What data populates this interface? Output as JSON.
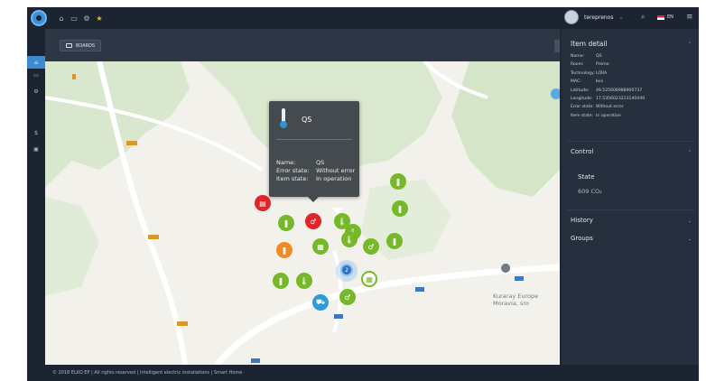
{
  "colors": {
    "accent": "#3a8bd1",
    "panel_bg": "#262f3d",
    "sensor_green": "#76b82a",
    "sensor_red": "#e0262a",
    "sensor_orange": "#f08a24",
    "sensor_blue": "#2f9bd8"
  },
  "topbar": {
    "user_name": "tereprenos",
    "language": "EN",
    "icons": [
      "home-icon",
      "boards-icon",
      "settings-icon",
      "star-icon",
      "search-icon",
      "hamburger-menu-icon"
    ]
  },
  "sidebar": {
    "items": [
      {
        "icon": "home-icon",
        "label": "⌂"
      },
      {
        "icon": "boards-icon",
        "label": "▭"
      },
      {
        "icon": "settings-icon",
        "label": "⚙"
      },
      {
        "icon": "dollar-icon",
        "label": "$"
      },
      {
        "icon": "id-card-icon",
        "label": "▣"
      }
    ]
  },
  "boards": {
    "label": "BOARDS"
  },
  "popup": {
    "title": "QS",
    "name_label": "Name:",
    "name_value": "QS",
    "error_label": "Error state:",
    "error_value": "Without error",
    "item_label": "Item state:",
    "item_value": "In operation"
  },
  "map": {
    "place_name_line1": "Kuraray Europe",
    "place_name_line2": "Moravia, sro",
    "cluster_count": "2",
    "road_labels": [
      "435",
      "432",
      "432",
      "432",
      "4347",
      "4347",
      "4347",
      "432"
    ]
  },
  "panel": {
    "item_detail_title": "Item detail",
    "details": [
      {
        "k": "Name:",
        "v": "QS"
      },
      {
        "k": "Room:",
        "v": "Promo"
      },
      {
        "k": "Technology:",
        "v": "LORA"
      },
      {
        "k": "MAC:",
        "v": "bos"
      },
      {
        "k": "Latitude:",
        "v": "49.525608988900737"
      },
      {
        "k": "Longitude:",
        "v": "17.5356023213140449"
      },
      {
        "k": "Error state:",
        "v": "Without error"
      },
      {
        "k": "Item state:",
        "v": "In operation"
      }
    ],
    "control_title": "Control",
    "state_label": "State",
    "state_value": "609 CO₂",
    "history_title": "History",
    "groups_title": "Groups"
  },
  "footer": {
    "text": "© 2018 ELKO EP | All rights reserved | Intelligent electric installations | Smart Home"
  }
}
